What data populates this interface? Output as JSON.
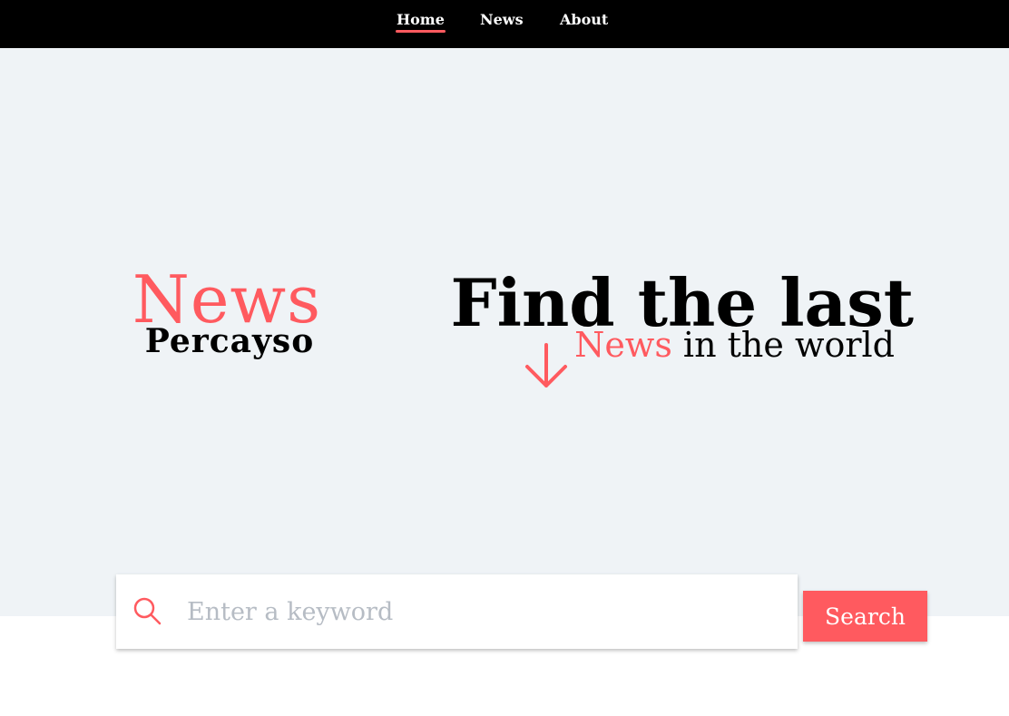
{
  "nav": {
    "items": [
      {
        "label": "Home",
        "active": true
      },
      {
        "label": "News",
        "active": false
      },
      {
        "label": "About",
        "active": false
      }
    ]
  },
  "hero": {
    "brand_top": "News",
    "brand_bottom": "Percayso",
    "headline": "Find the last",
    "subline_accent": "News",
    "subline_rest": "in the world",
    "arrow_icon": "arrow-down-icon"
  },
  "search": {
    "placeholder": "Enter a keyword",
    "value": "",
    "icon": "search-icon",
    "button_label": "Search"
  },
  "colors": {
    "accent": "#ff5a5f",
    "nav_background": "#000000",
    "hero_background": "#eff3f6"
  }
}
